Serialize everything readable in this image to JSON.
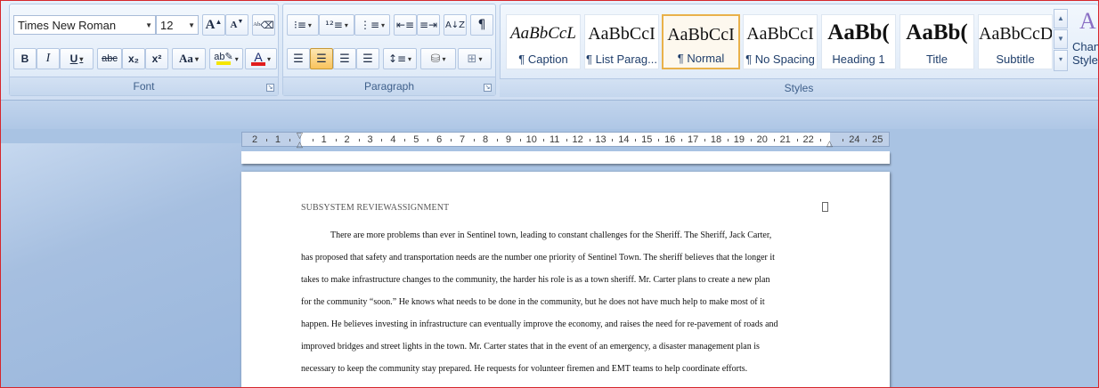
{
  "font_group": {
    "label": "Font",
    "font_name": "Times New Roman",
    "font_size": "12",
    "grow_font": "A",
    "shrink_font": "A",
    "bold": "B",
    "italic": "I",
    "underline": "U",
    "strikethrough": "abc",
    "subscript": "x₂",
    "superscript": "x²",
    "change_case": "Aa",
    "highlight_color": "#f5e600",
    "font_color": "#e11d1d"
  },
  "paragraph_group": {
    "label": "Paragraph"
  },
  "styles_group": {
    "label": "Styles",
    "change_styles_label": [
      "Chan",
      "Style"
    ],
    "tiles": [
      {
        "sample": "AaBbCcL",
        "name": "¶ Caption"
      },
      {
        "sample": "AaBbCcI",
        "name": "¶ List Parag..."
      },
      {
        "sample": "AaBbCcI",
        "name": "¶ Normal"
      },
      {
        "sample": "AaBbCcI",
        "name": "¶ No Spacing"
      },
      {
        "sample": "AaBb(",
        "name": "Heading 1"
      },
      {
        "sample": "AaBb(",
        "name": "Title"
      },
      {
        "sample": "AaBbCcD",
        "name": "Subtitle"
      }
    ]
  },
  "ruler": {
    "labels": [
      "2",
      "1",
      "",
      "1",
      "2",
      "3",
      "4",
      "5",
      "6",
      "7",
      "8",
      "9",
      "10",
      "11",
      "12",
      "13",
      "14",
      "15",
      "16",
      "17",
      "18",
      "19",
      "20",
      "21",
      "22",
      "",
      "24",
      "25"
    ]
  },
  "document": {
    "header": "SUBSYSTEM REVIEWASSIGNMENT",
    "lines": [
      "There are more problems than ever in Sentinel town, leading to constant challenges for the Sheriff. The Sheriff, Jack Carter,",
      "has proposed that safety and transportation needs are the number one priority of Sentinel Town. The sheriff believes that the longer it",
      "takes to make infrastructure changes to the community, the harder his role is as a town sheriff. Mr. Carter plans to create a new plan",
      "for the community “soon.” He knows what needs to be done in the community, but he does not have much help to make most of it",
      "happen. He believes investing in infrastructure can eventually improve the economy, and raises the need for re-pavement of roads and",
      "improved bridges and street lights in the town. Mr. Carter states that in the event of an emergency, a disaster management plan is",
      "necessary to keep the community stay prepared. He requests for volunteer firemen and EMT teams to help coordinate efforts."
    ]
  }
}
